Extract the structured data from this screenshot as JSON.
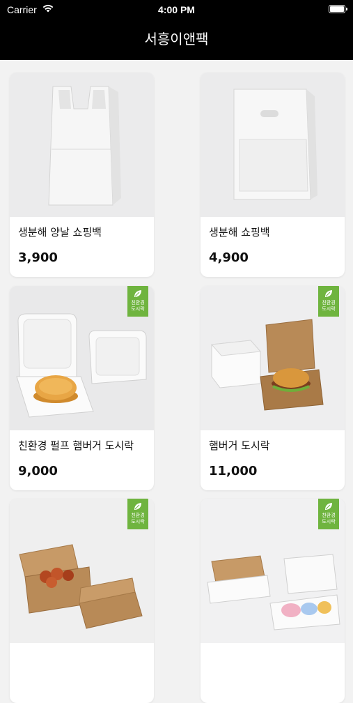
{
  "status": {
    "carrier": "Carrier",
    "time": "4:00 PM"
  },
  "header": {
    "title": "서흥이앤팩"
  },
  "eco_badge": {
    "line1": "친환경",
    "line2": "도시락"
  },
  "products": [
    {
      "name": "생분해 양날 쇼핑백",
      "price": "3,900"
    },
    {
      "name": "생분해 쇼핑백",
      "price": "4,900"
    },
    {
      "name": "친환경 펄프 햄버거 도시락",
      "price": "9,000"
    },
    {
      "name": "햄버거 도시락",
      "price": "11,000"
    },
    {
      "name": "",
      "price": ""
    },
    {
      "name": "",
      "price": ""
    }
  ]
}
